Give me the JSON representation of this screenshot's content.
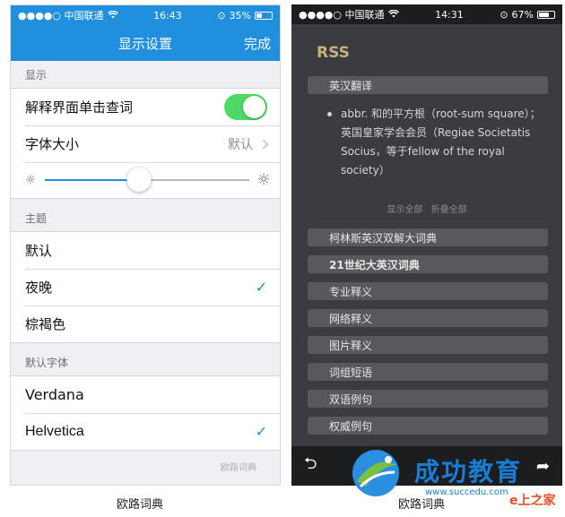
{
  "left": {
    "status": {
      "carrier": "●●●●○ 中国联通",
      "wifi": "wifi-icon",
      "time": "16:43",
      "battery_pct": "35%",
      "battery_level": 0.35
    },
    "nav": {
      "title": "显示设置",
      "done": "完成"
    },
    "section_display": "显示",
    "tap_lookup": {
      "label": "解释界面单击查词",
      "enabled": true
    },
    "font_size": {
      "label": "字体大小",
      "value": "默认"
    },
    "brightness": {
      "level": 0.46
    },
    "section_theme": "主题",
    "themes": [
      {
        "label": "默认",
        "checked": false
      },
      {
        "label": "夜晚",
        "checked": true
      },
      {
        "label": "棕褐色",
        "checked": false
      }
    ],
    "section_font": "默认字体",
    "fonts": [
      {
        "label": "Verdana",
        "checked": false
      },
      {
        "label": "Helvetica",
        "checked": true
      }
    ],
    "watermark": "欧路词典"
  },
  "right": {
    "status": {
      "carrier": "●●●●○ 中国联通",
      "wifi": "wifi-icon",
      "time": "14:31",
      "battery_pct": "67%",
      "battery_level": 0.67
    },
    "heading": "RSS",
    "first_dict": "英汉翻译",
    "definition": "abbr. 和的平方根（root-sum square）；英国皇家学会会员（Regiae Societatis Socius，等于fellow of the royal society）",
    "show_all": "显示全部",
    "collapse_all": "折叠全部",
    "dicts": [
      "柯林斯英汉双解大词典",
      "21世纪大英汉词典",
      "专业释义",
      "网络释义",
      "图片释义",
      "词组短语",
      "双语例句",
      "权威例句"
    ],
    "toolbar": {
      "back": "back-arrow-icon",
      "share": "share-icon"
    }
  },
  "logo": {
    "name": "成功教育",
    "url": "www.succedu.com",
    "side": "e上之家"
  },
  "captions": {
    "left": "欧路词典",
    "right": "欧路词典"
  }
}
